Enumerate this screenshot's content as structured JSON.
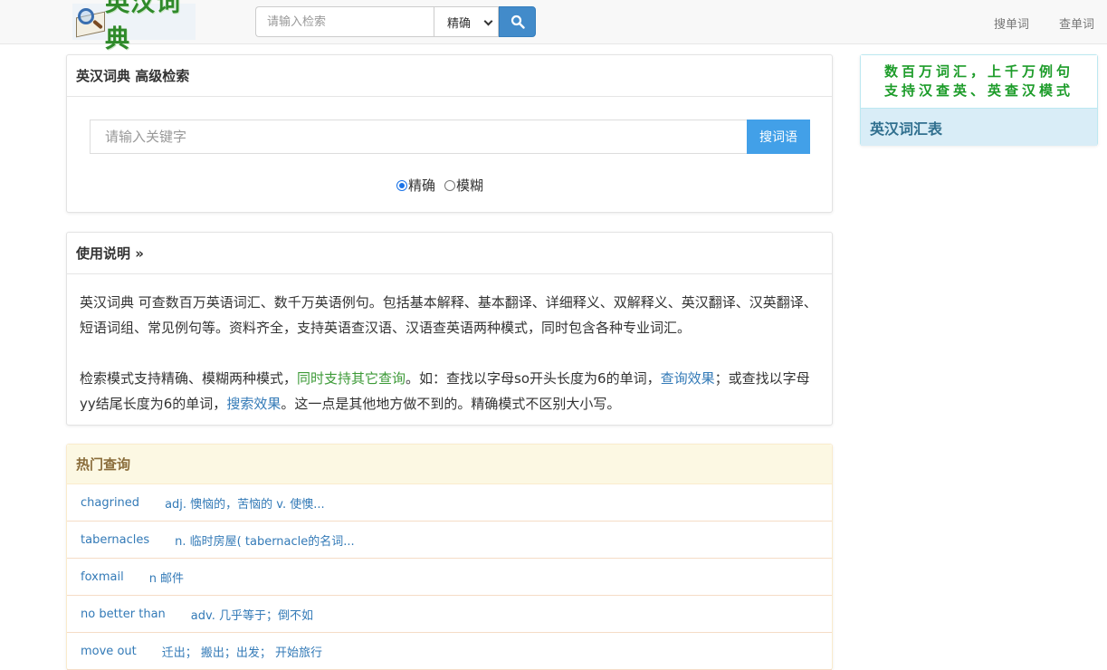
{
  "logo": {
    "text": "英汉词典"
  },
  "nav": {
    "search_placeholder": "请输入检索",
    "mode_selected": "精确",
    "link1": "搜单词",
    "link2": "查单词"
  },
  "advanced": {
    "title": "英汉词典 高级检索",
    "placeholder": "请输入关键字",
    "button": "搜词语",
    "radio_exact": "精确",
    "radio_fuzzy": "模糊"
  },
  "usage": {
    "title": "使用说明 »",
    "para1": "英汉词典 可查数百万英语词汇、数千万英语例句。包括基本解释、基本翻译、详细释义、双解释义、英汉翻译、汉英翻译、短语词组、常见例句等。资料齐全，支持英语查汉语、汉语查英语两种模式，同时包含各种专业词汇。",
    "para2_a": "检索模式支持精确、模糊两种模式，",
    "para2_green": "同时支持其它查询",
    "para2_b": "。如：查找以字母so开头长度为6的单词，",
    "para2_link1": "查询效果",
    "para2_c": "；或查找以字母yy结尾长度为6的单词，",
    "para2_link2": "搜索效果",
    "para2_d": "。这一点是其他地方做不到的。精确模式不区别大小写。"
  },
  "hot": {
    "title": "热门查询",
    "items": [
      {
        "word": "chagrined",
        "def": "adj. 懊恼的，苦恼的 v. 使懊..."
      },
      {
        "word": "tabernacles",
        "def": "n. 临时房屋( tabernacle的名词..."
      },
      {
        "word": "foxmail",
        "def": "n 邮件"
      },
      {
        "word": "no better than",
        "def": "adv. 几乎等于；倒不如"
      },
      {
        "word": "move out",
        "def": "迁出； 搬出；出发； 开始旅行"
      }
    ]
  },
  "sidebar": {
    "banner_line1": "数百万词汇，上千万例句",
    "banner_line2": "支持汉查英、英查汉模式",
    "title": "英汉词汇表"
  },
  "colors": {
    "accent": "#428bca",
    "button": "#42a0e8",
    "green": "#3c9a37",
    "link": "#337ab7"
  }
}
